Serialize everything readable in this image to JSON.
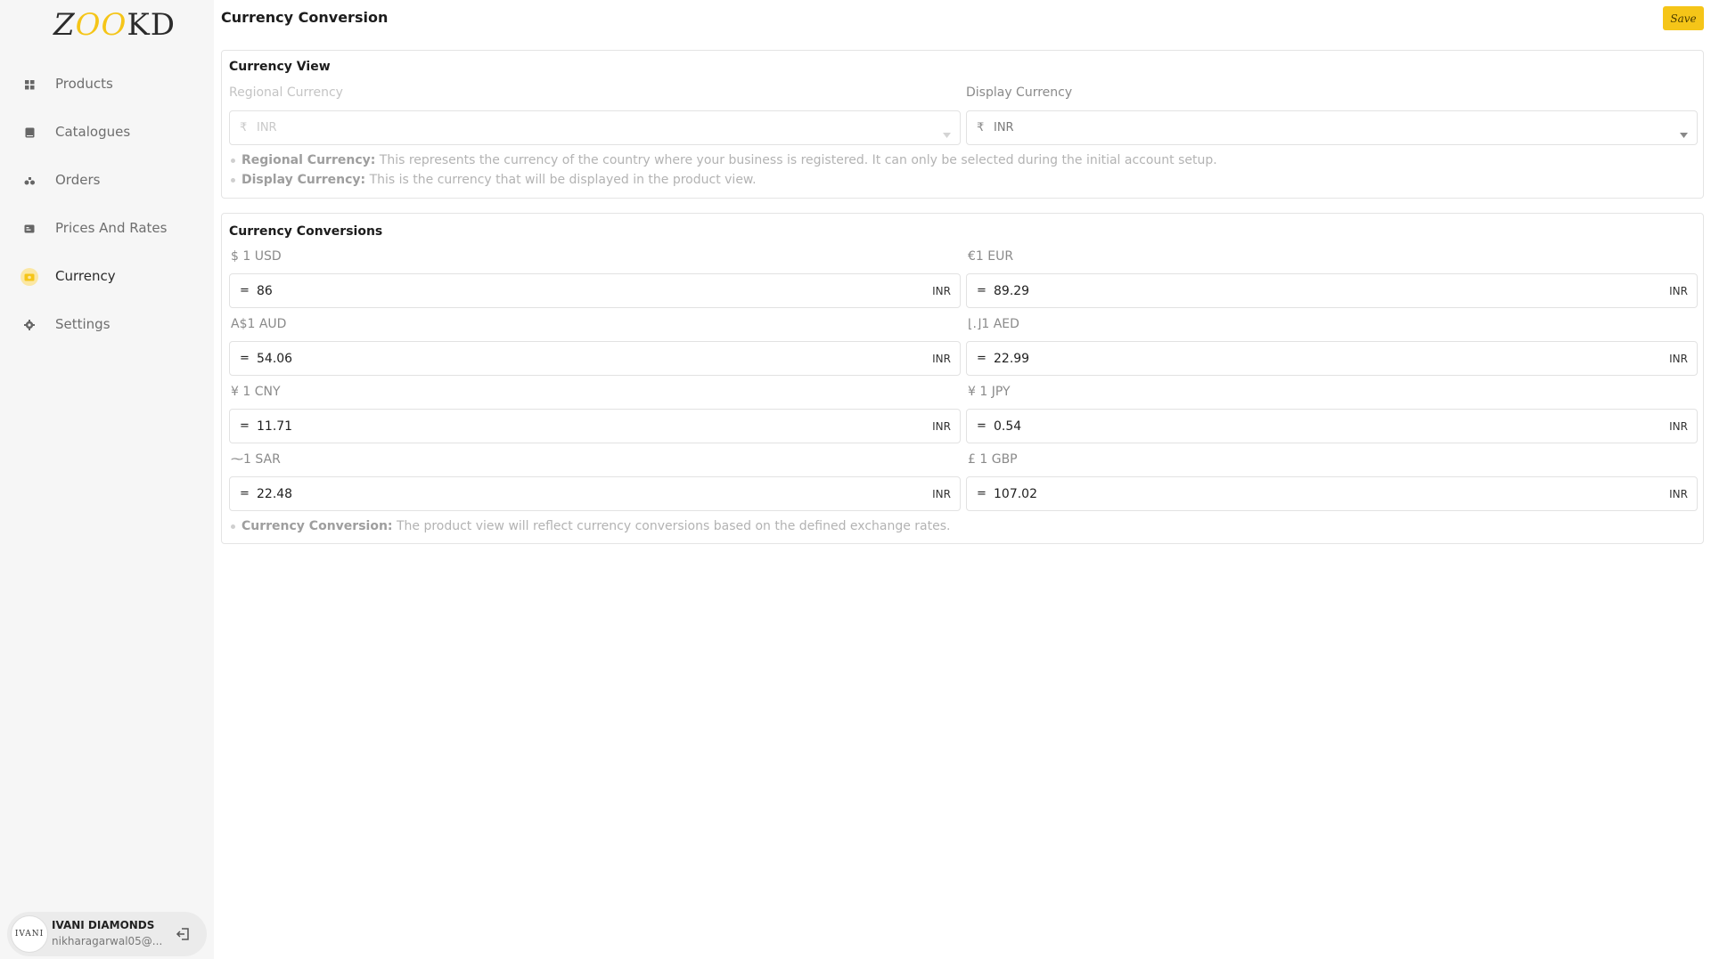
{
  "brand": {
    "logo_text": "ZOOKD",
    "logo_z": "Z",
    "logo_oo": "OO",
    "logo_kd": "KD"
  },
  "sidebar": {
    "items": [
      {
        "label": "Products",
        "icon": "grid-icon",
        "active": false
      },
      {
        "label": "Catalogues",
        "icon": "book-icon",
        "active": false
      },
      {
        "label": "Orders",
        "icon": "orders-icon",
        "active": false
      },
      {
        "label": "Prices And Rates",
        "icon": "price-tag-icon",
        "active": false
      },
      {
        "label": "Currency",
        "icon": "currency-icon",
        "active": true
      },
      {
        "label": "Settings",
        "icon": "gear-icon",
        "active": false
      }
    ]
  },
  "user": {
    "avatar_text": "IVANI",
    "name": "IVANI DIAMONDS",
    "email": "nikharagarwal05@..."
  },
  "header": {
    "title": "Currency Conversion",
    "save_label": "Save"
  },
  "currency_view": {
    "title": "Currency View",
    "regional_label": "Regional Currency",
    "regional_symbol": "₹",
    "regional_value": "INR",
    "display_label": "Display Currency",
    "display_symbol": "₹",
    "display_value": "INR",
    "notes": [
      {
        "term": "Regional Currency:",
        "text": " This represents the currency of the country where your business is registered. It can only be selected during the initial account setup."
      },
      {
        "term": "Display Currency:",
        "text": " This is the currency that will be displayed in the product view."
      }
    ]
  },
  "conversions": {
    "title": "Currency Conversions",
    "equals": "=",
    "unit": "INR",
    "rates": [
      {
        "label": "$ 1 USD",
        "value": "86"
      },
      {
        "label": "€1 EUR",
        "value": "89.29"
      },
      {
        "label": "A$1 AUD",
        "value": "54.06"
      },
      {
        "label": "⌊.⌋1 AED",
        "value": "22.99"
      },
      {
        "label": "¥ 1 CNY",
        "value": "11.71"
      },
      {
        "label": "¥ 1 JPY",
        "value": "0.54"
      },
      {
        "label": "⁓1 SAR",
        "value": "22.48"
      },
      {
        "label": "£ 1 GBP",
        "value": "107.02"
      }
    ],
    "note": {
      "term": "Currency Conversion:",
      "text": " The product view will reflect currency conversions based on the defined exchange rates."
    }
  },
  "colors": {
    "accent": "#f5c518",
    "sidebar_bg": "#f6f6f6",
    "border": "#e2e2e2"
  }
}
